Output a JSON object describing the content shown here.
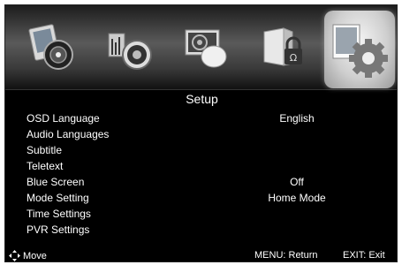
{
  "tabs": [
    {
      "icon": "picture-icon"
    },
    {
      "icon": "music-icon"
    },
    {
      "icon": "video-icon"
    },
    {
      "icon": "lock-icon"
    },
    {
      "icon": "gear-icon",
      "selected": true
    }
  ],
  "menu": {
    "title": "Setup",
    "items": [
      {
        "label": "OSD Language",
        "value": "English"
      },
      {
        "label": "Audio Languages",
        "value": ""
      },
      {
        "label": "Subtitle",
        "value": ""
      },
      {
        "label": "Teletext",
        "value": ""
      },
      {
        "label": "Blue Screen",
        "value": "Off"
      },
      {
        "label": "Mode Setting",
        "value": "Home Mode"
      },
      {
        "label": "Time Settings",
        "value": ""
      },
      {
        "label": "PVR Settings",
        "value": ""
      }
    ]
  },
  "footer": {
    "move_label": "Move",
    "return_label": "MENU: Return",
    "exit_label": "EXIT: Exit"
  }
}
